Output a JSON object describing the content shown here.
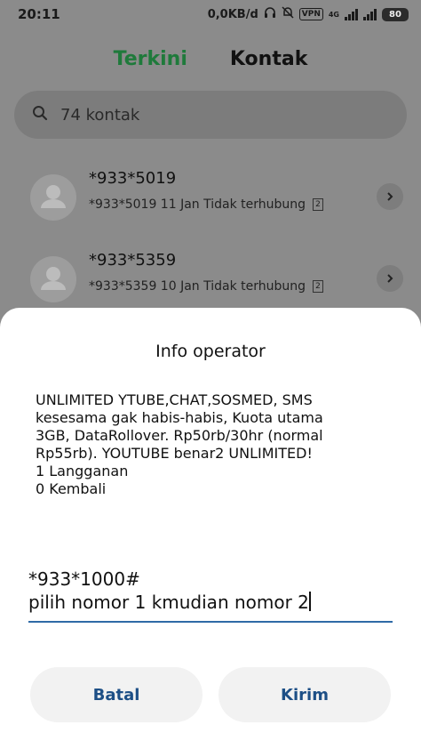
{
  "status_bar": {
    "time": "20:11",
    "data_rate": "0,0KB/d",
    "vpn": "VPN",
    "network": "4G",
    "battery": "80"
  },
  "tabs": [
    {
      "label": "Terkini",
      "active": true
    },
    {
      "label": "Kontak",
      "active": false
    }
  ],
  "search": {
    "placeholder": "74 kontak"
  },
  "contacts": [
    {
      "name": "*933*5019",
      "detail": "*933*5019  11 Jan Tidak terhubung",
      "badge": "2"
    },
    {
      "name": "*933*5359",
      "detail": "*933*5359  10 Jan Tidak terhubung",
      "badge": "2"
    }
  ],
  "dialog": {
    "title": "Info operator",
    "message_lines": [
      "UNLIMITED YTUBE,CHAT,SOSMED, SMS",
      "kesesama gak habis-habis, Kuota utama",
      "3GB, DataRollover. Rp50rb/30hr (normal",
      "Rp55rb). YOUTUBE benar2 UNLIMITED!",
      "1 Langganan",
      "0 Kembali"
    ],
    "input_lines": [
      "*933*1000#",
      "pilih nomor 1 kmudian nomor 2"
    ],
    "cancel_label": "Batal",
    "send_label": "Kirim"
  },
  "colors": {
    "active_tab": "#1f7a3b",
    "button_text": "#1d4f86",
    "input_underline": "#2f6aa6"
  }
}
